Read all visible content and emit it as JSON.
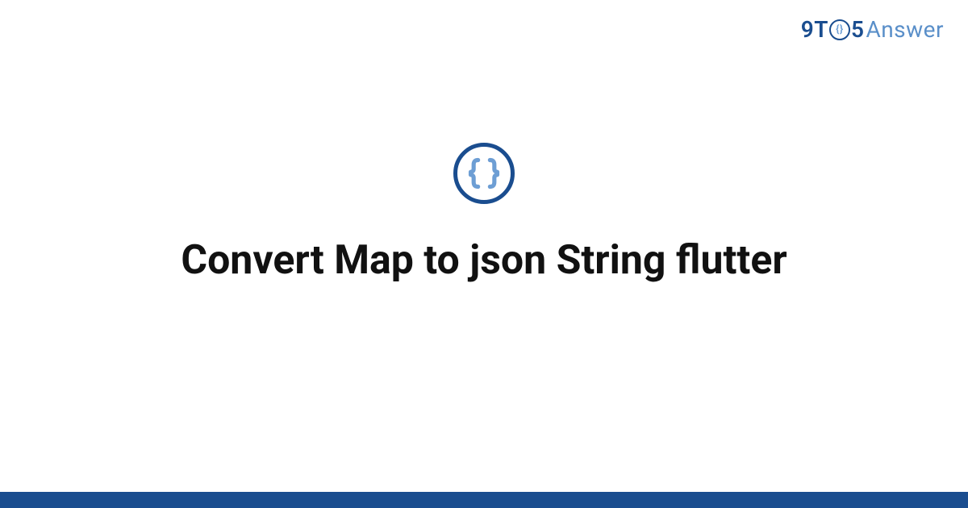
{
  "header": {
    "logo_nine_t": "9T",
    "logo_o_inner": "{}",
    "logo_five": "5",
    "logo_answer": "Answer"
  },
  "main": {
    "icon_name": "code-braces",
    "title": "Convert Map to json String flutter"
  },
  "colors": {
    "primary": "#1a4d8f",
    "accent": "#5a8fc9",
    "text": "#111111"
  }
}
